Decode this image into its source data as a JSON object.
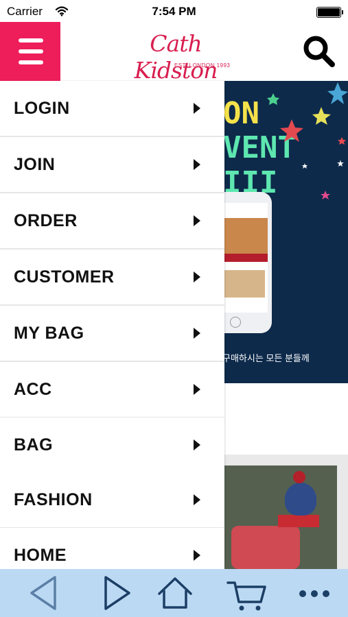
{
  "status_bar": {
    "carrier": "Carrier",
    "time": "7:54 PM"
  },
  "header": {
    "logo_text": "Cath Kidston",
    "logo_tagline": "EST. LONDON 1993",
    "menu_icon": "hamburger-icon",
    "search_icon": "search-icon"
  },
  "banner": {
    "title_line1": "ON",
    "title_line2": "VENT III",
    "caption": "구매하시는 모든 분들께"
  },
  "drawer": {
    "items": [
      {
        "label": "LOGIN"
      },
      {
        "label": "JOIN"
      },
      {
        "label": "ORDER"
      },
      {
        "label": "CUSTOMER"
      },
      {
        "label": "MY BAG"
      },
      {
        "label": "ACC"
      },
      {
        "label": "BAG"
      },
      {
        "label": "FASHION"
      },
      {
        "label": "HOME"
      }
    ]
  },
  "toolbar": {
    "buttons": [
      "back-icon",
      "forward-icon",
      "home-icon",
      "cart-icon",
      "more-icon"
    ]
  },
  "colors": {
    "brand_pink": "#ee1e5b",
    "logo_red": "#d81e4f",
    "banner_navy": "#0d2a4b",
    "toolbar_blue": "#bcd9f3",
    "toolbar_icon": "#1c3f66"
  }
}
